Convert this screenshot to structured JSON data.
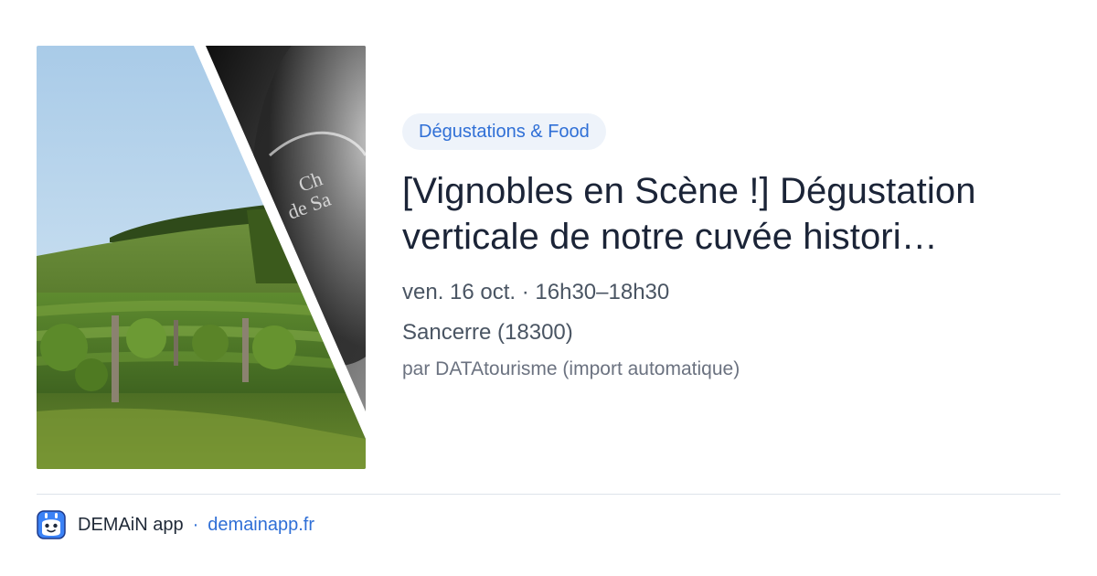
{
  "event": {
    "category": "Dégustations & Food",
    "title_line1": "[Vignobles en Scène !] Dégustation",
    "title_line2": "verticale de notre cuvée histori…",
    "datetime": "ven. 16 oct. · 16h30–18h30",
    "location": "Sancerre (18300)",
    "source": "par DATAtourisme (import automatique)",
    "image_alt": "Vineyard hillside and wine glass"
  },
  "footer": {
    "app_name": "DEMAiN app",
    "separator": "·",
    "url": "demainapp.fr"
  },
  "colors": {
    "accent": "#2f6fd6",
    "chip_bg": "#eef3fa",
    "title": "#1b2437",
    "meta": "#4a5563",
    "muted": "#6b7280",
    "divider": "#dde3ea"
  }
}
